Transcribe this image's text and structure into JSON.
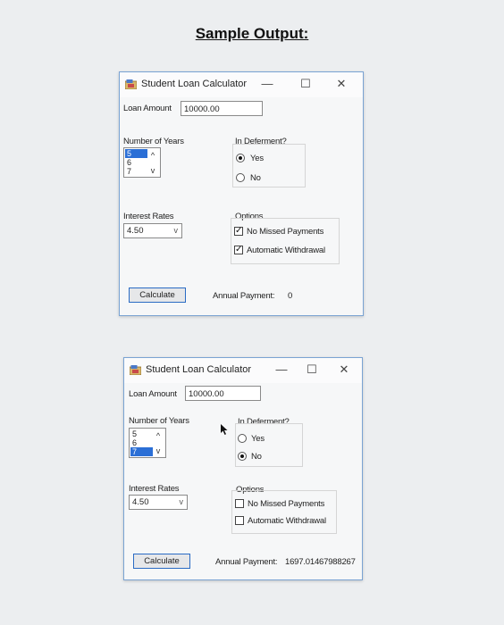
{
  "page_title": "Sample Output:",
  "windows": [
    {
      "title": "Student Loan Calculator",
      "controls": {
        "minimize": "—",
        "maximize": "☐",
        "close": "✕"
      },
      "loan_amount_label": "Loan Amount",
      "loan_amount_value": "10000.00",
      "years_label": "Number of Years",
      "years_items": [
        "5",
        "6",
        "7"
      ],
      "years_selected": "5",
      "deferment_label": "In Deferment?",
      "deferment_yes": "Yes",
      "deferment_no": "No",
      "deferment_selected": "Yes",
      "rates_label": "Interest Rates",
      "rates_value": "4.50",
      "options_label": "Options",
      "option_no_missed": "No Missed Payments",
      "option_no_missed_checked": true,
      "option_auto_withdrawal": "Automatic Withdrawal",
      "option_auto_withdrawal_checked": true,
      "calculate_label": "Calculate",
      "annual_payment_label": "Annual Payment:",
      "annual_payment_value": "0"
    },
    {
      "title": "Student Loan Calculator",
      "controls": {
        "minimize": "—",
        "maximize": "☐",
        "close": "✕"
      },
      "loan_amount_label": "Loan Amount",
      "loan_amount_value": "10000.00",
      "years_label": "Number of Years",
      "years_items": [
        "5",
        "6",
        "7"
      ],
      "years_selected": "7",
      "deferment_label": "In Deferment?",
      "deferment_yes": "Yes",
      "deferment_no": "No",
      "deferment_selected": "No",
      "rates_label": "Interest Rates",
      "rates_value": "4.50",
      "options_label": "Options",
      "option_no_missed": "No Missed Payments",
      "option_no_missed_checked": false,
      "option_auto_withdrawal": "Automatic Withdrawal",
      "option_auto_withdrawal_checked": false,
      "calculate_label": "Calculate",
      "annual_payment_label": "Annual Payment:",
      "annual_payment_value": "1697.01467988267"
    }
  ]
}
